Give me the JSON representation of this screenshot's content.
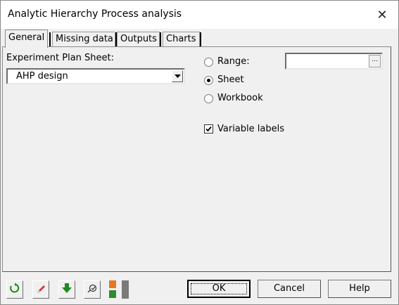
{
  "window": {
    "title": "Analytic Hierarchy Process analysis",
    "close_glyph": "✕"
  },
  "tabs": [
    {
      "label": "General",
      "active": true
    },
    {
      "label": "Missing data",
      "active": false
    },
    {
      "label": "Outputs",
      "active": false
    },
    {
      "label": "Charts",
      "active": false
    }
  ],
  "general": {
    "plan_sheet_label": "Experiment Plan Sheet:",
    "plan_sheet_value": "AHP design",
    "range_label": "Range:",
    "range_value": "",
    "range_button_label": "...",
    "sheet_label": "Sheet",
    "workbook_label": "Workbook",
    "selected_location": "Sheet",
    "variable_labels_label": "Variable labels",
    "variable_labels_checked": true
  },
  "toolbar": {
    "icons": [
      "reset-icon",
      "eraser-icon",
      "down-arrow-icon",
      "pin-icon",
      "layout-icon"
    ]
  },
  "buttons": {
    "ok": "OK",
    "cancel": "Cancel",
    "help": "Help"
  },
  "colors": {
    "dialog_bg": "#f0f0f0",
    "reset_green": "#1a8a1a",
    "arrow_green": "#1f8a1f",
    "eraser_red": "#d23b3b",
    "layout_orange": "#e87722",
    "layout_green": "#2e8b2e",
    "layout_gray": "#7a7a7a"
  }
}
